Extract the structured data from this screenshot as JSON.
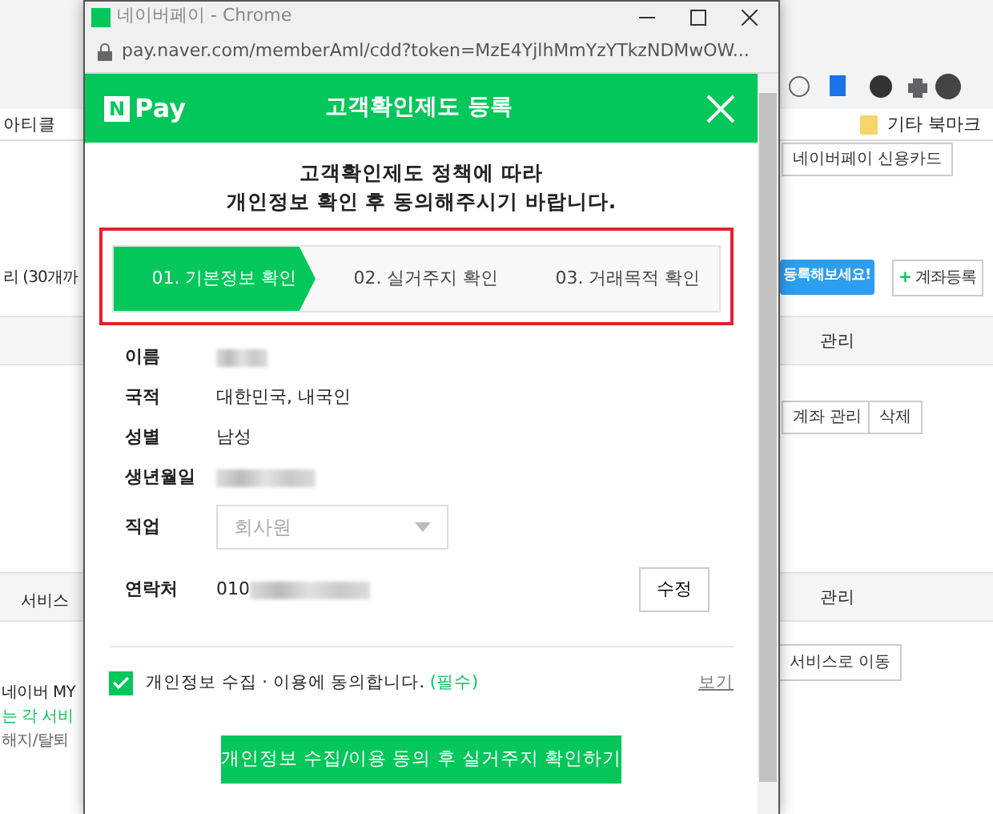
{
  "background": {
    "bookmark_left": "아티클",
    "bookmark_folder": "기타 북마크",
    "card_button": "네이버페이 신용카드",
    "count_label": "리 (30개까",
    "tooltip": "등록해보세요!",
    "add_account_button": {
      "icon": "+",
      "label": "계좌등록"
    },
    "account_header": "관리",
    "account_buttons": [
      "계좌 관리",
      "삭제"
    ],
    "service_header": "서비스",
    "service_manage": "관리",
    "service_row": "네이버 MY",
    "service_button": "서비스로 이동",
    "notes": [
      {
        "text": "는 각 서비",
        "kind": "accent"
      },
      {
        "text": "해지/탈퇴",
        "kind": "plain"
      }
    ]
  },
  "popup": {
    "window_title": "네이버페이 - Chrome",
    "url": "pay.naver.com/memberAml/cdd?token=MzE4YjlhMmYzYTkzNDMwOW...",
    "logo": {
      "mark": "N",
      "text": "Pay"
    },
    "title": "고객확인제도 등록",
    "intro": [
      "고객확인제도 정책에 따라",
      "개인정보 확인 후 동의해주시기 바랍니다."
    ],
    "steps": [
      {
        "label": "01. 기본정보 확인",
        "selected": true
      },
      {
        "label": "02. 실거주지 확인",
        "selected": false
      },
      {
        "label": "03. 거래목적 확인",
        "selected": false
      }
    ],
    "fields": [
      {
        "label": "이름",
        "kind": "text",
        "masked": true
      },
      {
        "label": "국적",
        "kind": "text",
        "value": "대한민국, 내국인",
        "masked": false
      },
      {
        "label": "성별",
        "kind": "text",
        "value": "남성",
        "masked": false
      },
      {
        "label": "생년월일",
        "kind": "text",
        "masked": true
      },
      {
        "label": "직업",
        "kind": "select",
        "value": "회사원",
        "disabled": true
      },
      {
        "label": "연락처",
        "kind": "text",
        "value": "010",
        "masked": true,
        "action": "수정"
      }
    ],
    "consent": {
      "text": "개인정보 수집 · 이용에 동의합니다.",
      "required": "(필수)",
      "checked": true,
      "link": "보기"
    },
    "submit": "개인정보 수집/이용 동의 후 실거주지 확인하기"
  }
}
